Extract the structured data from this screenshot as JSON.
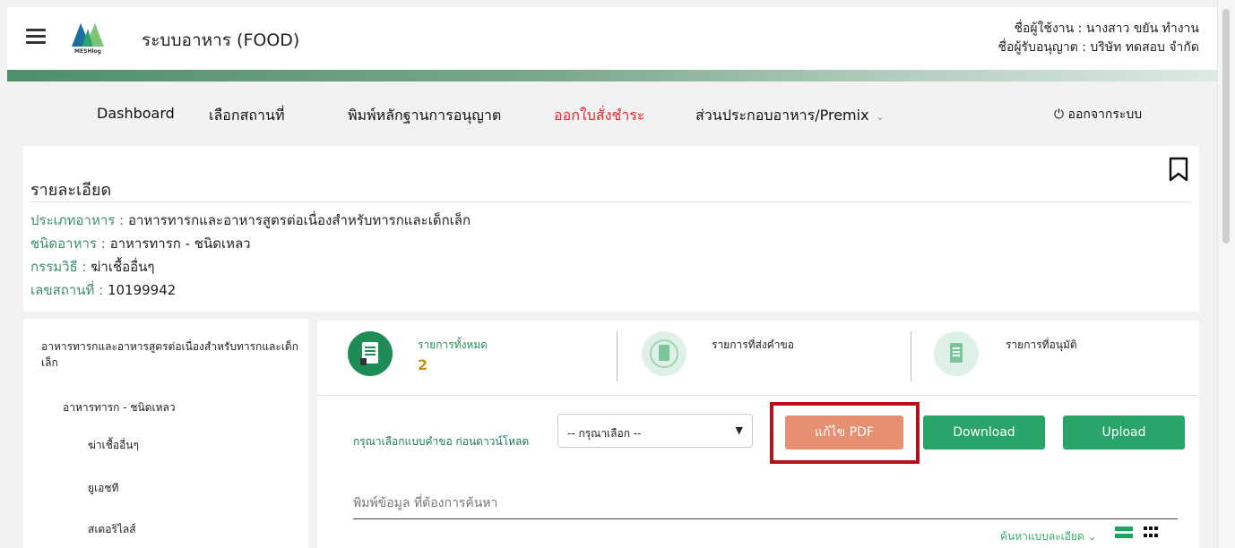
{
  "header": {
    "logo_text": "MESHlog",
    "app_title": "ระบบอาหาร (FOOD)",
    "user_line": "ชื่อผู้ใช้งาน : นางสาว ขยัน ทำงาน",
    "licensee_line": "ชื่อผู้รับอนุญาต : บริษัท ทดสอบ จำกัด"
  },
  "nav": {
    "items": [
      {
        "label": "Dashboard"
      },
      {
        "label": "เลือกสถานที่"
      },
      {
        "label": "พิมพ์หลักฐานการอนุญาต"
      },
      {
        "label": "ออกใบสั่งชำระ",
        "active": true
      },
      {
        "label": "ส่วนประกอบอาหาร/Premix"
      }
    ],
    "logout": "ออกจากระบบ",
    "logout_icon": "power-icon"
  },
  "details": {
    "title": "รายละเอียด",
    "rows": [
      {
        "label": "ประเภทอาหาร : ",
        "value": "อาหารทารกและอาหารสูตรต่อเนื่องสำหรับทารกและเด็กเล็ก"
      },
      {
        "label": "ชนิดอาหาร : ",
        "value": "อาหารทารก - ชนิดเหลว"
      },
      {
        "label": "กรรมวิธี : ",
        "value": "ฆ่าเชื้ออื่นๆ"
      },
      {
        "label": "เลขสถานที่ : ",
        "value": "10199942"
      }
    ]
  },
  "sidebar": {
    "heading": "อาหารทารกและอาหารสูตรต่อเนื่องสำหรับทารกและเด็กเล็ก",
    "sub": "อาหารทารก - ชนิดเหลว",
    "items": [
      "ฆ่าเชื้ออื่นๆ",
      "ยูเอชที",
      "สเตอริไลส์"
    ]
  },
  "stats": [
    {
      "label": "รายการทั้งหมด",
      "count": "2"
    },
    {
      "label": "รายการที่ส่งคำขอ",
      "count": ""
    },
    {
      "label": "รายการที่อนุมัติ",
      "count": ""
    }
  ],
  "tools": {
    "select_label": "กรุณาเลือกแบบคำขอ ก่อนดาวน์โหลด",
    "select_value": "-- กรุณาเลือก --",
    "btn_pdf": "แก้ไข PDF",
    "btn_download": "Download",
    "btn_upload": "Upload",
    "search_placeholder": "พิมพ์ข้อมูล ที่ต้องการค้นหา",
    "adv_search": "ค้นหาแบบละเอียด ⌄"
  },
  "colors": {
    "brand_green": "#2aa56a",
    "active_nav": "#e8242c",
    "pdf_button": "#e79071",
    "highlight": "#b3141c"
  }
}
